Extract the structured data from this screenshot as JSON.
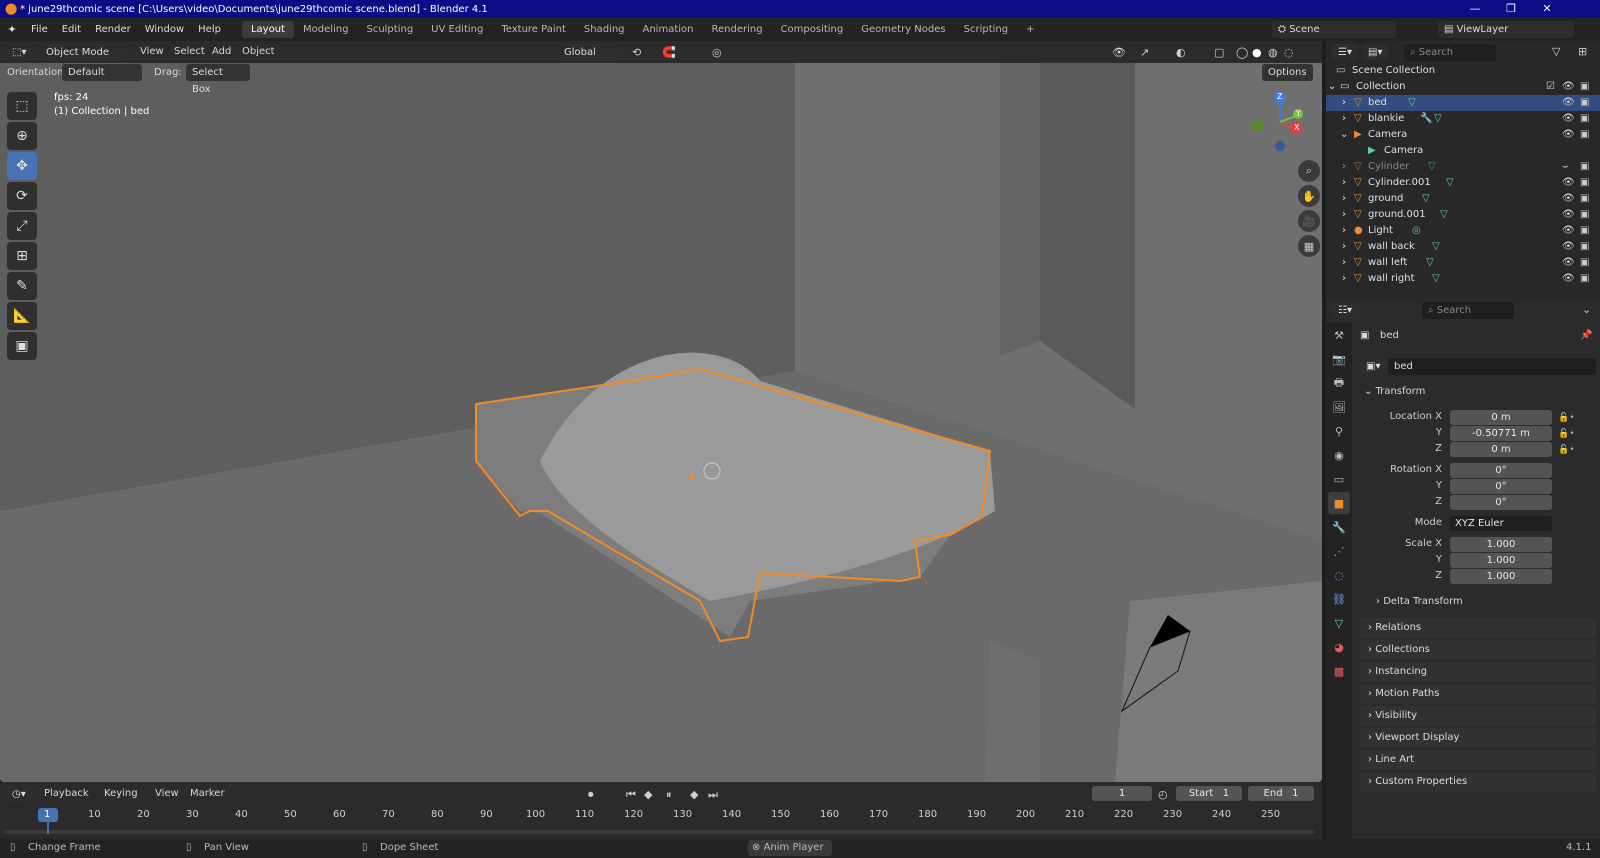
{
  "window": {
    "title": "* june29thcomic scene [C:\\Users\\video\\Documents\\june29thcomic scene.blend] - Blender 4.1"
  },
  "menus": [
    "File",
    "Edit",
    "Render",
    "Window",
    "Help"
  ],
  "workspaces": [
    "Layout",
    "Modeling",
    "Sculpting",
    "UV Editing",
    "Texture Paint",
    "Shading",
    "Animation",
    "Rendering",
    "Compositing",
    "Geometry Nodes",
    "Scripting"
  ],
  "active_workspace": "Layout",
  "scene": {
    "label": "Scene",
    "view_layer": "ViewLayer"
  },
  "viewport_header": {
    "mode": "Object Mode",
    "items": [
      "View",
      "Select",
      "Add",
      "Object"
    ],
    "transform": "Global"
  },
  "viewport_sub": {
    "orientation_label": "Orientation:",
    "orientation": "Default",
    "drag_label": "Drag:",
    "drag": "Select Box",
    "options": "Options"
  },
  "overlay": {
    "fps": "fps: 24",
    "collection": "(1) Collection | bed"
  },
  "gizmo": {
    "z": "Z",
    "y": "Y",
    "x": "X"
  },
  "outliner": {
    "search_placeholder": "Search",
    "root": "Scene Collection",
    "collection": "Collection",
    "items": [
      {
        "name": "bed",
        "selected": true
      },
      {
        "name": "blankie"
      },
      {
        "name": "Camera",
        "expanded": true
      },
      {
        "name": "Camera",
        "child": true
      },
      {
        "name": "Cylinder",
        "dim": true
      },
      {
        "name": "Cylinder.001"
      },
      {
        "name": "ground"
      },
      {
        "name": "ground.001"
      },
      {
        "name": "Light"
      },
      {
        "name": "wall back"
      },
      {
        "name": "wall left"
      },
      {
        "name": "wall right"
      }
    ]
  },
  "properties": {
    "search_placeholder": "Search",
    "object_name": "bed",
    "data_name": "bed",
    "transform_label": "Transform",
    "location_label": "Location X",
    "location": [
      "0 m",
      "-0.50771 m",
      "0 m"
    ],
    "rotation_label": "Rotation X",
    "rotation": [
      "0°",
      "0°",
      "0°"
    ],
    "mode_label": "Mode",
    "mode": "XYZ Euler",
    "scale_label": "Scale X",
    "scale": [
      "1.000",
      "1.000",
      "1.000"
    ],
    "y_label": "Y",
    "z_label": "Z",
    "delta": "Delta Transform",
    "panels": [
      "Relations",
      "Collections",
      "Instancing",
      "Motion Paths",
      "Visibility",
      "Viewport Display",
      "Line Art",
      "Custom Properties"
    ]
  },
  "timeline": {
    "menus": [
      "Playback",
      "Keying",
      "View",
      "Marker"
    ],
    "current_frame": "1",
    "start_label": "Start",
    "start": "1",
    "end_label": "End",
    "end": "1",
    "ticks": [
      "1",
      "10",
      "20",
      "30",
      "40",
      "50",
      "60",
      "70",
      "80",
      "90",
      "100",
      "110",
      "120",
      "130",
      "140",
      "150",
      "160",
      "170",
      "180",
      "190",
      "200",
      "210",
      "220",
      "230",
      "240",
      "250"
    ]
  },
  "status": {
    "change_frame": "Change Frame",
    "pan_view": "Pan View",
    "dope_sheet": "Dope Sheet",
    "anim_player": "Anim Player",
    "version": "4.1.1"
  },
  "colors": {
    "accent": "#4772b3",
    "selection_outline": "#f28a26",
    "title_bar": "#0c0c86"
  }
}
